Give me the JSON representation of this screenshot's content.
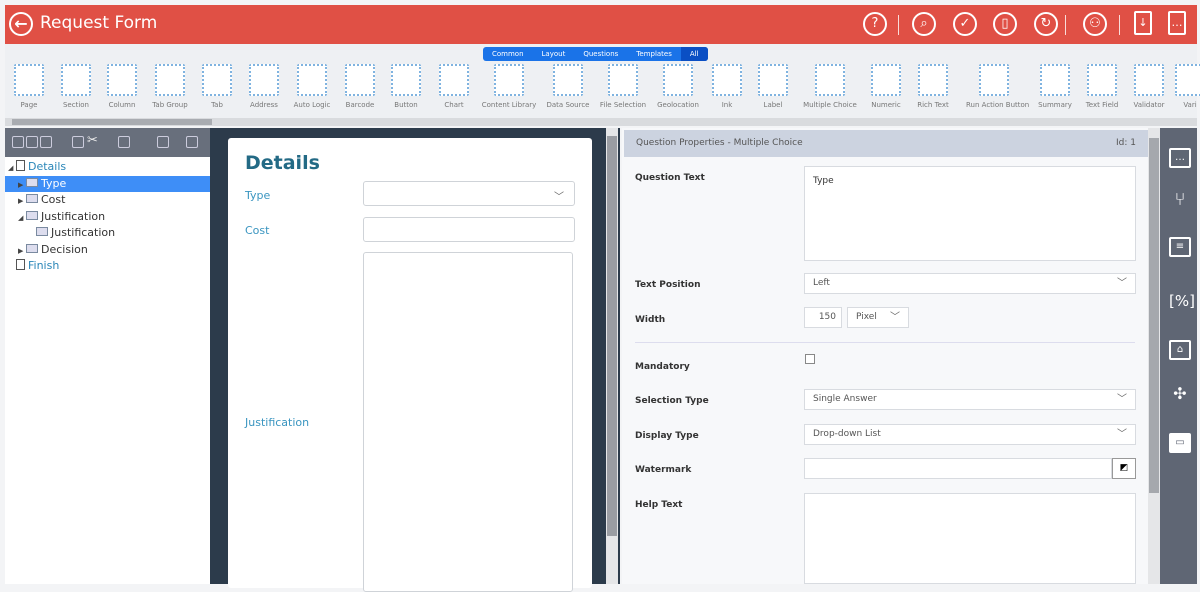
{
  "header": {
    "title": "Request Form",
    "back_icon": "back-arrow-icon",
    "actions": [
      {
        "name": "help",
        "glyph": "?"
      },
      {
        "name": "search",
        "glyph": "⌕"
      },
      {
        "name": "validate",
        "glyph": "✓"
      },
      {
        "name": "preview",
        "glyph": "▯"
      },
      {
        "name": "refresh",
        "glyph": "↻"
      },
      {
        "name": "share",
        "glyph": "⚇"
      },
      {
        "name": "export",
        "glyph": "↓"
      },
      {
        "name": "export-more",
        "glyph": "…"
      }
    ]
  },
  "toolbar": {
    "tabs": [
      "Common",
      "Layout",
      "Questions",
      "Templates",
      "All"
    ],
    "active_tab": "All",
    "items": [
      "Page",
      "Section",
      "Column",
      "Tab Group",
      "Tab",
      "Address",
      "Auto Logic",
      "Barcode",
      "Button",
      "Chart",
      "Content Library",
      "Data Source",
      "File Selection",
      "Geolocation",
      "Ink",
      "Label",
      "Multiple Choice",
      "Numeric",
      "Rich Text",
      "Run Action Button",
      "Summary",
      "Text Field",
      "Validator",
      "Vari"
    ]
  },
  "tree": [
    {
      "label": "Details",
      "level": 0,
      "expanded": true,
      "type": "page"
    },
    {
      "label": "Type",
      "level": 1,
      "selected": true,
      "collapsed": true
    },
    {
      "label": "Cost",
      "level": 1,
      "collapsed": true
    },
    {
      "label": "Justification",
      "level": 1,
      "expanded": true
    },
    {
      "label": "Justification",
      "level": 2
    },
    {
      "label": "Decision",
      "level": 1,
      "collapsed": true
    },
    {
      "label": "Finish",
      "level": 0,
      "type": "page"
    }
  ],
  "form": {
    "title": "Details",
    "fields": {
      "type": "Type",
      "cost": "Cost",
      "justification": "Justification"
    }
  },
  "properties": {
    "header": "Question Properties - Multiple Choice",
    "id": "Id: 1",
    "question_text_label": "Question Text",
    "question_text": "Type",
    "text_position_label": "Text Position",
    "text_position": "Left",
    "width_label": "Width",
    "width_value": "150",
    "width_unit": "Pixel",
    "mandatory_label": "Mandatory",
    "mandatory": false,
    "selection_type_label": "Selection Type",
    "selection_type": "Single Answer",
    "display_type_label": "Display Type",
    "display_type": "Drop-down List",
    "watermark_label": "Watermark",
    "watermark": "",
    "help_text_label": "Help Text",
    "help_text": ""
  },
  "colors": {
    "header": "#e05045",
    "accent": "#1a73e8",
    "selected": "#3e8ef7"
  }
}
